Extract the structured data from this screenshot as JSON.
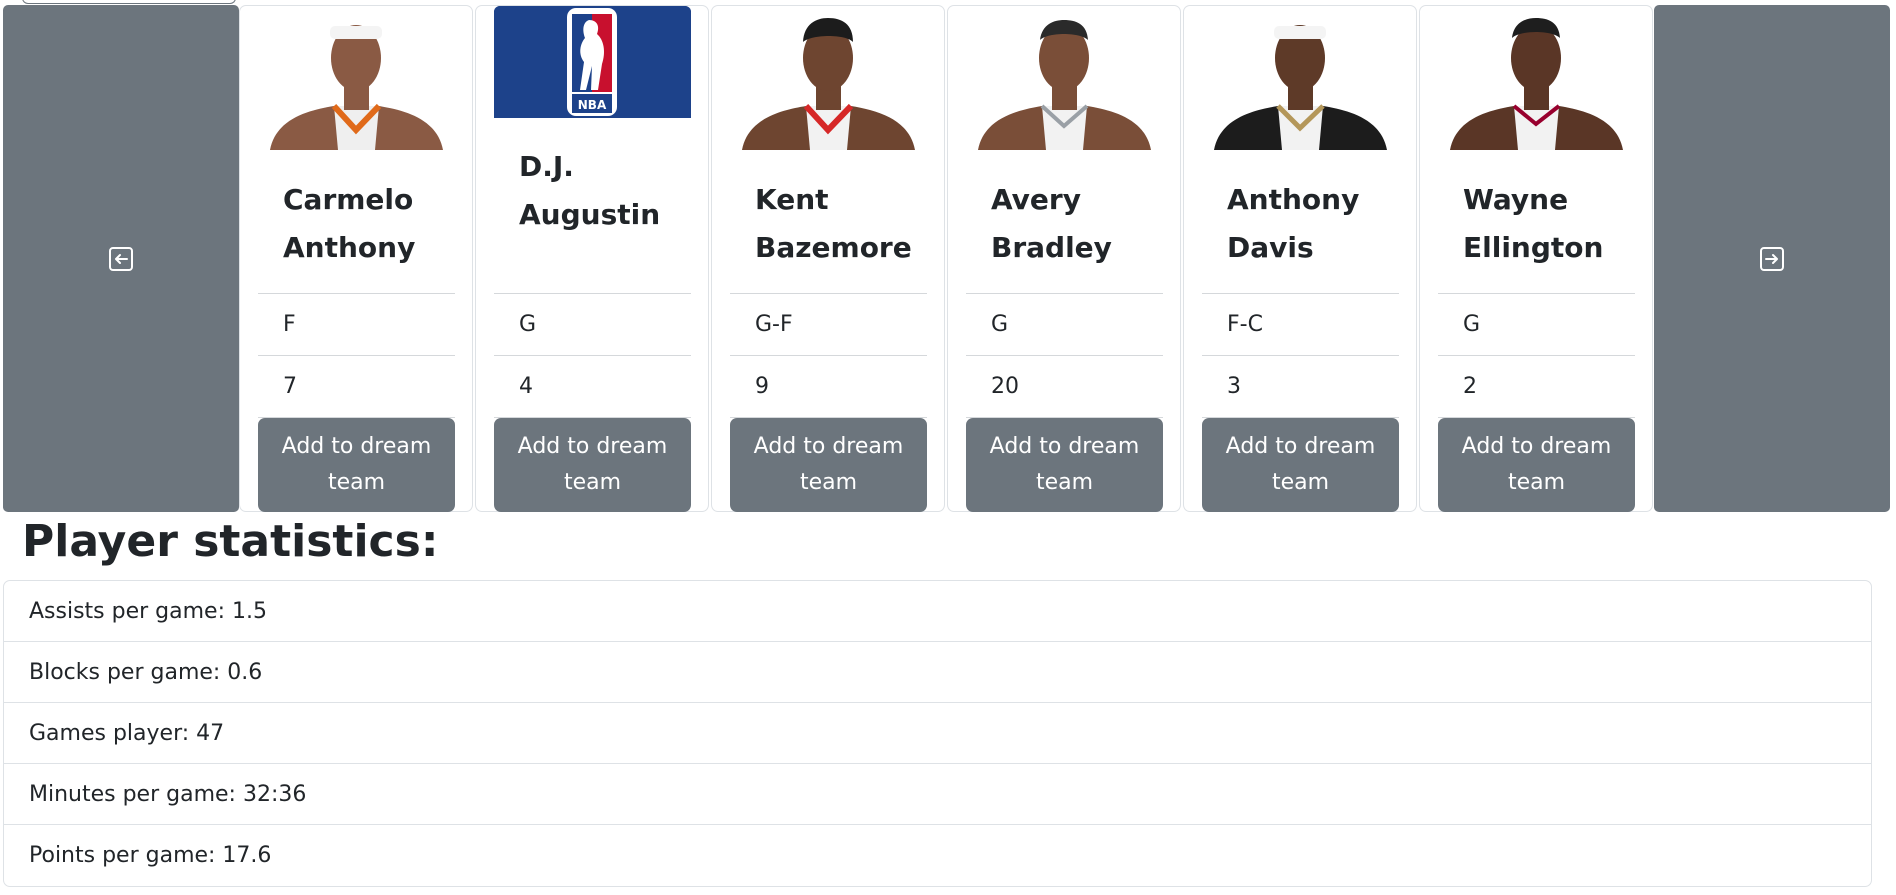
{
  "carousel": {
    "prev_icon": "arrow-left-square-icon",
    "next_icon": "arrow-right-square-icon",
    "add_label": "Add to dream team",
    "players": [
      {
        "name": "Carmelo Anthony",
        "position": "F",
        "number": "7",
        "photo": "player-photo"
      },
      {
        "name": "D.J. Augustin",
        "position": "G",
        "number": "4",
        "photo": "nba-logo"
      },
      {
        "name": "Kent Bazemore",
        "position": "G-F",
        "number": "9",
        "photo": "player-photo"
      },
      {
        "name": "Avery Bradley",
        "position": "G",
        "number": "20",
        "photo": "player-photo"
      },
      {
        "name": "Anthony Davis",
        "position": "F-C",
        "number": "3",
        "photo": "player-photo"
      },
      {
        "name": "Wayne Ellington",
        "position": "G",
        "number": "2",
        "photo": "player-photo"
      }
    ]
  },
  "stats": {
    "title": "Player statistics:",
    "items": [
      "Assists per game: 1.5",
      "Blocks per game: 0.6",
      "Games player: 47",
      "Minutes per game: 32:36",
      "Points per game: 17.6"
    ]
  },
  "colors": {
    "button_gray": "#6c757d",
    "border": "#dee2e6",
    "text": "#212529",
    "nba_blue": "#1d428a",
    "nba_red": "#c8102e"
  }
}
